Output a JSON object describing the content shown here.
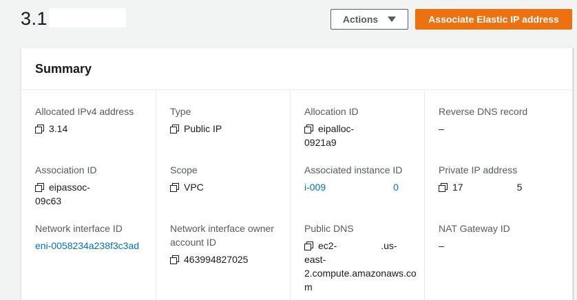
{
  "page": {
    "title_visible": "3.1"
  },
  "header_actions": {
    "actions_label": "Actions",
    "associate_label": "Associate Elastic IP address"
  },
  "summary": {
    "heading": "Summary",
    "fields": {
      "allocated_ipv4": {
        "label": "Allocated IPv4 address",
        "value": "3.14"
      },
      "type": {
        "label": "Type",
        "value": "Public IP"
      },
      "allocation_id": {
        "label": "Allocation ID",
        "value_line1": "eipalloc-",
        "value_line2": "0921a9"
      },
      "reverse_dns": {
        "label": "Reverse DNS record",
        "value": "–"
      },
      "association_id": {
        "label": "Association ID",
        "value_line1": "eipassoc-",
        "value_line2": "09c63"
      },
      "scope": {
        "label": "Scope",
        "value": "VPC"
      },
      "associated_instance": {
        "label": "Associated instance ID",
        "value_start": "i-009",
        "value_end": "0"
      },
      "private_ip": {
        "label": "Private IP address",
        "value_start": "17",
        "value_end": "5"
      },
      "eni": {
        "label": "Network interface ID",
        "value": "eni-0058234a238f3c3ad"
      },
      "eni_owner": {
        "label_line1": "Network interface owner",
        "label_line2": "account ID",
        "value": "463994827025"
      },
      "public_dns": {
        "label": "Public DNS",
        "value_line1_start": "ec2-",
        "value_line1_end": ".us-",
        "value_line2": "east-",
        "value_line3": "2.compute.amazonaws.co",
        "value_line4": "m"
      },
      "nat_gateway": {
        "label": "NAT Gateway ID",
        "value": "–"
      }
    }
  },
  "colors": {
    "primary_button": "#ec7211",
    "link": "#0073bb",
    "page_bg": "#f2f3f3"
  },
  "icons": [
    "copy-icon",
    "caret-down-icon"
  ]
}
